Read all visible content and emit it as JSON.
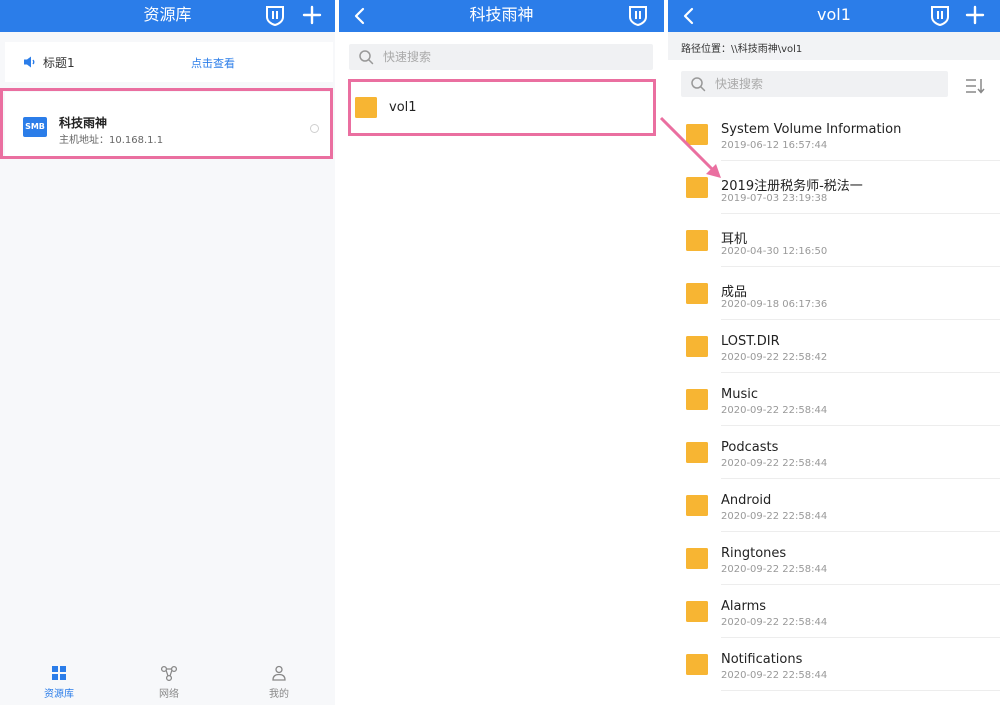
{
  "colors": {
    "accent": "#2b7de9",
    "highlight": "#ea6fa0",
    "folder": "#f7b533"
  },
  "panel1": {
    "title": "资源库",
    "notice": {
      "label": "标题1",
      "link": "点击查看"
    },
    "server": {
      "badge": "SMB",
      "name": "科技雨神",
      "address": "主机地址：10.168.1.1"
    },
    "nav": [
      {
        "label": "资源库",
        "icon": "grid-icon",
        "active": true
      },
      {
        "label": "网络",
        "icon": "network-icon",
        "active": false
      },
      {
        "label": "我的",
        "icon": "user-icon",
        "active": false
      }
    ]
  },
  "panel2": {
    "title": "科技雨神",
    "search_placeholder": "快速搜索",
    "items": [
      {
        "name": "vol1"
      }
    ]
  },
  "panel3": {
    "title": "vol1",
    "path": "路径位置：\\\\科技雨神\\vol1",
    "search_placeholder": "快速搜索",
    "files": [
      {
        "name": "System Volume Information",
        "date": "2019-06-12 16:57:44"
      },
      {
        "name": "2019注册税务师-税法一",
        "date": "2019-07-03 23:19:38"
      },
      {
        "name": "耳机",
        "date": "2020-04-30 12:16:50"
      },
      {
        "name": "成品",
        "date": "2020-09-18 06:17:36"
      },
      {
        "name": "LOST.DIR",
        "date": "2020-09-22 22:58:42"
      },
      {
        "name": "Music",
        "date": "2020-09-22 22:58:44"
      },
      {
        "name": "Podcasts",
        "date": "2020-09-22 22:58:44"
      },
      {
        "name": "Android",
        "date": "2020-09-22 22:58:44"
      },
      {
        "name": "Ringtones",
        "date": "2020-09-22 22:58:44"
      },
      {
        "name": "Alarms",
        "date": "2020-09-22 22:58:44"
      },
      {
        "name": "Notifications",
        "date": "2020-09-22 22:58:44"
      }
    ]
  }
}
